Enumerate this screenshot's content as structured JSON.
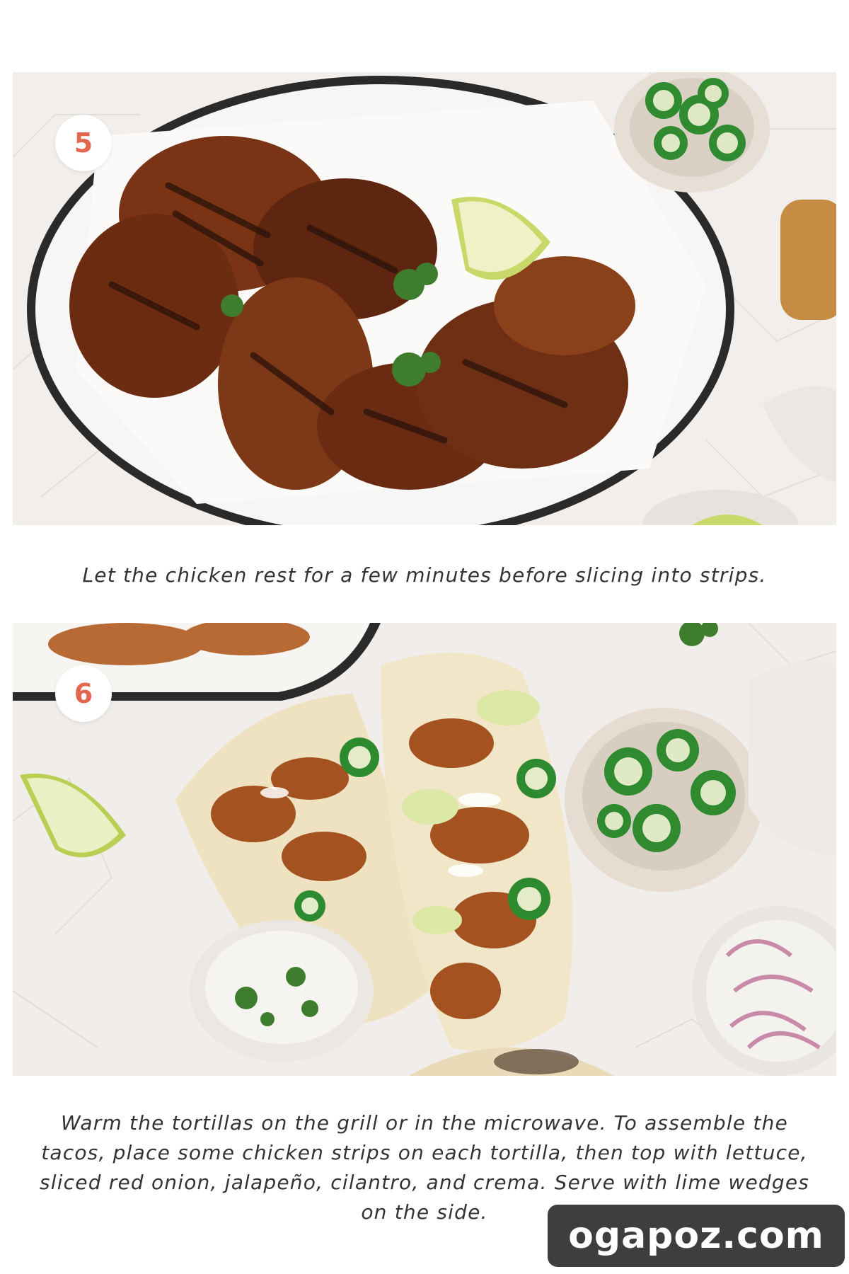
{
  "step5": {
    "badge": "5",
    "caption": "Let the chicken rest for a few minutes before slicing into strips."
  },
  "step6": {
    "badge": "6",
    "caption": "Warm the tortillas on the grill or in the microwave. To assemble the tacos, place some chicken strips on each tortilla, then top with lettuce, sliced red onion, jalapeño, cilantro, and crema. Serve with lime wedges on the side."
  },
  "watermark": "ogapoz.com",
  "colors": {
    "badge_text": "#e3664f",
    "caption_text": "#333333",
    "watermark_bg": "#3e3e3e"
  }
}
